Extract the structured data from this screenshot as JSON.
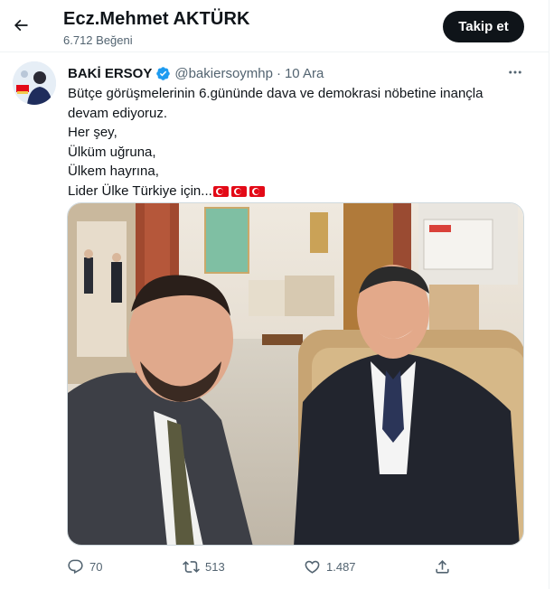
{
  "header": {
    "title": "Ecz.Mehmet AKTÜRK",
    "subtitle": "6.712 Beğeni",
    "follow_label": "Takip et"
  },
  "tweet": {
    "author_name": "BAKİ ERSOY",
    "handle": "@bakiersoymhp",
    "separator": "·",
    "date": "10 Ara",
    "lines": [
      "Bütçe görüşmelerinin 6.gününde dava ve demokrasi nöbetine inançla",
      "devam ediyoruz.",
      "Her şey,",
      "Ülküm uğruna,",
      "Ülkem hayrına,",
      "Lider Ülke Türkiye için..."
    ],
    "flag_emoji": "🇹🇷🇹🇷🇹🇷",
    "stats": {
      "replies": "70",
      "retweets": "513",
      "likes": "1.487"
    }
  },
  "colors": {
    "text": "#0f1419",
    "muted": "#536471",
    "verified": "#1d9bf0",
    "follow_bg": "#0f1419"
  },
  "icons": [
    "back-arrow-icon",
    "verified-badge-icon",
    "more-dots-icon",
    "reply-icon",
    "retweet-icon",
    "like-icon",
    "share-icon"
  ]
}
